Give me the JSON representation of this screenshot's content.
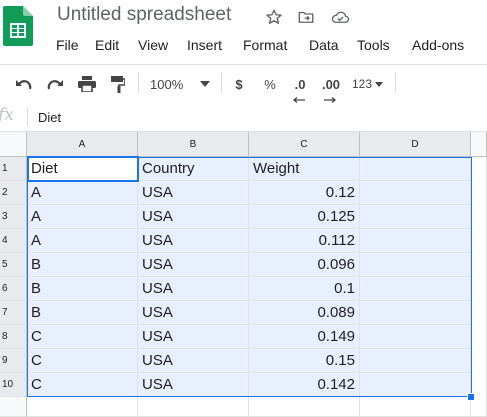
{
  "app": {
    "title": "Untitled spreadsheet",
    "menu": [
      "File",
      "Edit",
      "View",
      "Insert",
      "Format",
      "Data",
      "Tools",
      "Add-ons"
    ],
    "icons": [
      "star-icon",
      "move-to-folder-icon",
      "cloud-status-icon"
    ]
  },
  "toolbar": {
    "zoom": "100%",
    "currency": "$",
    "percent": "%",
    "decrease_decimal": ".0",
    "increase_decimal": ".00",
    "number_format": "123"
  },
  "formula_bar": {
    "fx": "fx",
    "value": "Diet"
  },
  "sheet": {
    "columns": [
      "A",
      "B",
      "C",
      "D"
    ],
    "row_numbers": [
      "1",
      "2",
      "3",
      "4",
      "5",
      "6",
      "7",
      "8",
      "9",
      "10"
    ],
    "rows": [
      [
        "Diet",
        "Country",
        "Weight",
        ""
      ],
      [
        "A",
        "USA",
        "0.12",
        ""
      ],
      [
        "A",
        "USA",
        "0.125",
        ""
      ],
      [
        "A",
        "USA",
        "0.112",
        ""
      ],
      [
        "B",
        "USA",
        "0.096",
        ""
      ],
      [
        "B",
        "USA",
        "0.1",
        ""
      ],
      [
        "B",
        "USA",
        "0.089",
        ""
      ],
      [
        "C",
        "USA",
        "0.149",
        ""
      ],
      [
        "C",
        "USA",
        "0.15",
        ""
      ],
      [
        "C",
        "USA",
        "0.142",
        ""
      ]
    ],
    "active_cell": "A1"
  },
  "colors": {
    "accent": "#1a73e8",
    "selection_fill": "#e8f0fe",
    "sheets_green": "#0f9d58"
  }
}
